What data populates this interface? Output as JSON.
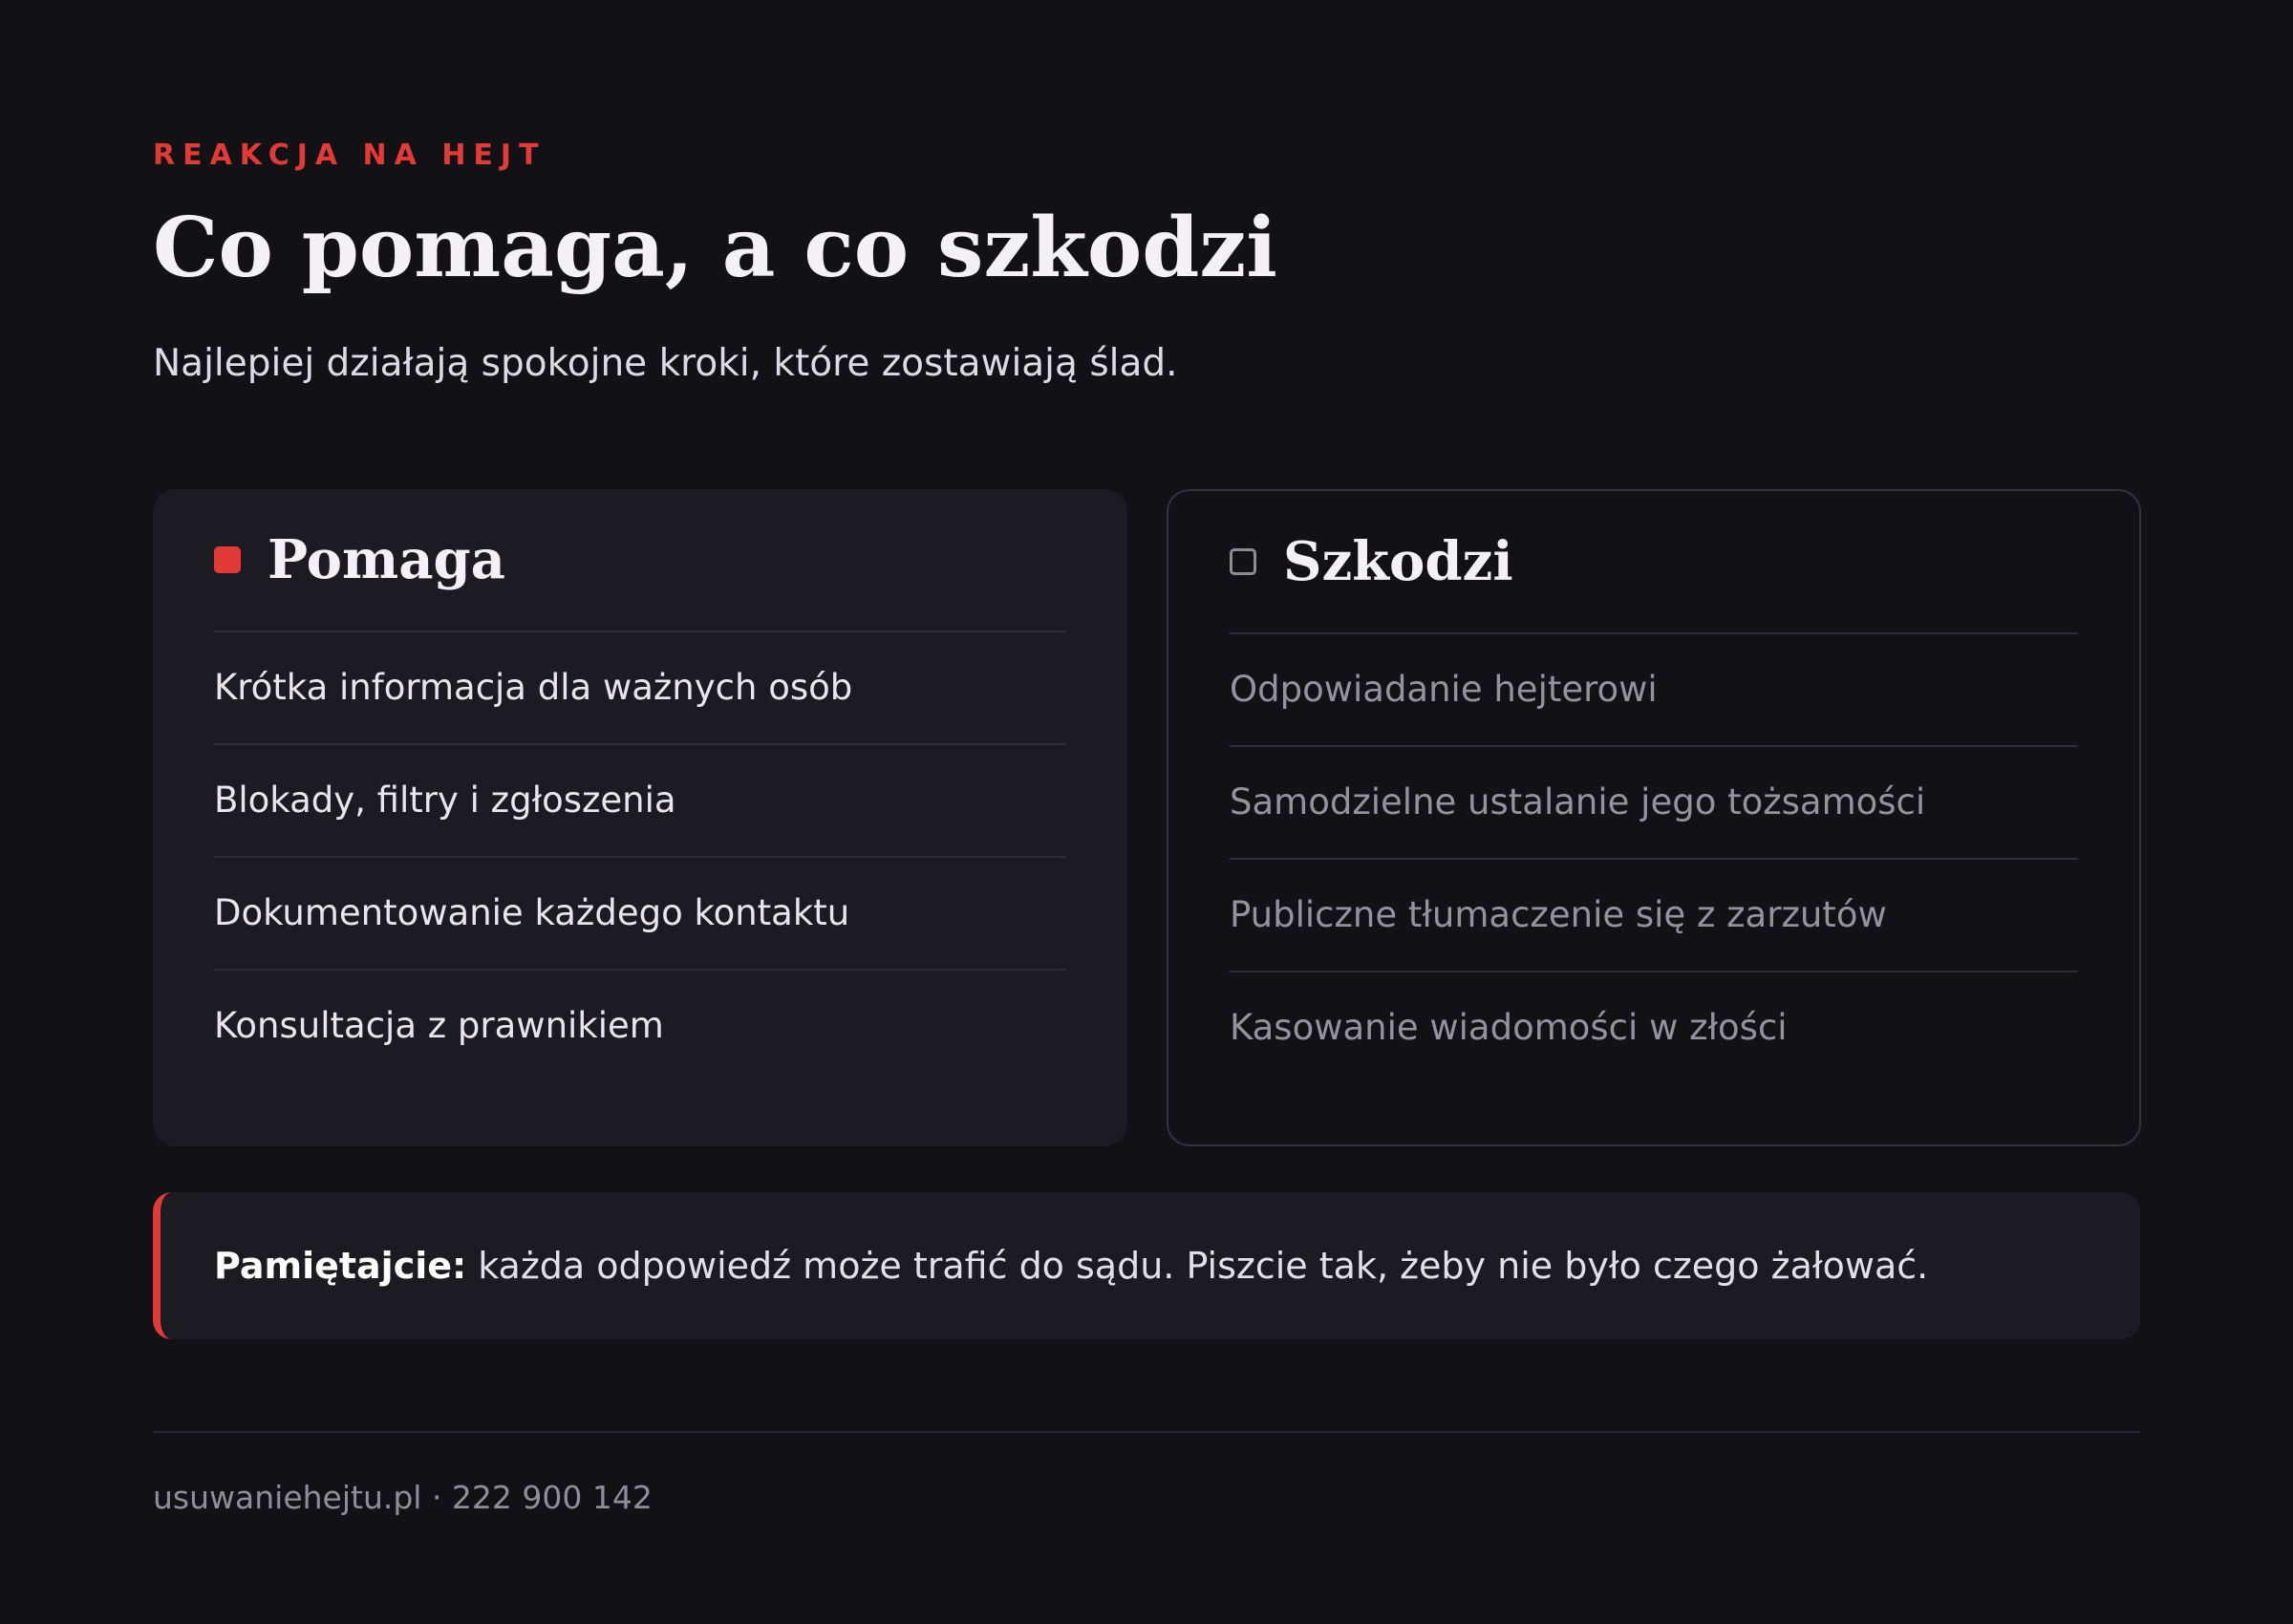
{
  "header": {
    "eyebrow": "REAKCJA NA HEJT",
    "title": "Co pomaga, a co szkodzi",
    "subtitle": "Najlepiej działają spokojne kroki, które zostawiają ślad."
  },
  "colors": {
    "accent": "#e23b36",
    "background": "#121116",
    "card": "#1c1b22"
  },
  "cards": {
    "help": {
      "icon": "filled-square-icon",
      "title": "Pomaga",
      "items": [
        "Krótka informacja dla ważnych osób",
        "Blokady, filtry i zgłoszenia",
        "Dokumentowanie każdego kontaktu",
        "Konsultacja z prawnikiem"
      ]
    },
    "harm": {
      "icon": "hollow-square-icon",
      "title": "Szkodzi",
      "items": [
        "Odpowiadanie hejterowi",
        "Samodzielne ustalanie jego tożsamości",
        "Publiczne tłumaczenie się z zarzutów",
        "Kasowanie wiadomości w złości"
      ]
    }
  },
  "note": {
    "label": "Pamiętajcie:",
    "text": "każda odpowiedź może trafić do sądu. Piszcie tak, żeby nie było czego żałować."
  },
  "footer": {
    "text": "usuwaniehejtu.pl · 222 900 142"
  }
}
